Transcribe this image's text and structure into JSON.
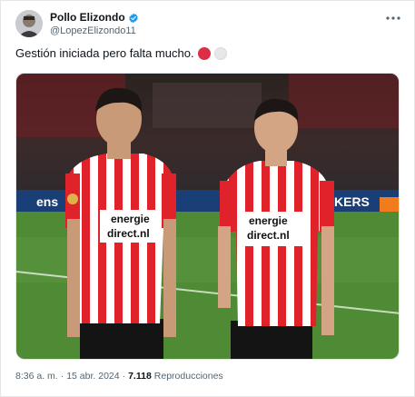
{
  "author": {
    "display_name": "Pollo Elizondo",
    "handle": "@LopezElizondo11",
    "verified": true
  },
  "tweet": {
    "text": "Gestión iniciada pero falta mucho.",
    "emoji_icons": [
      "red-circle-icon",
      "white-circle-icon"
    ]
  },
  "media": {
    "shirt_sponsor_line1": "energie",
    "shirt_sponsor_line2": "direct.nl",
    "board_text_left": "ens",
    "board_text_right": "KERS"
  },
  "meta": {
    "time": "8:36 a. m.",
    "separator": "·",
    "date": "15 abr. 2024",
    "separator2": "·",
    "views": "7.118",
    "views_label": "Reproducciones"
  },
  "colors": {
    "psv_red": "#e0232b",
    "pitch_green": "#4f8a34",
    "verified_blue": "#1d9bf0"
  }
}
